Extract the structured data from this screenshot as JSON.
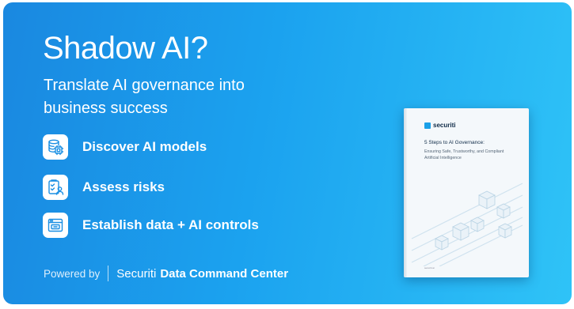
{
  "headline": "Shadow AI?",
  "subhead": "Translate AI governance into business success",
  "features": [
    {
      "label": "Discover AI models",
      "icon": "database-chip-icon"
    },
    {
      "label": "Assess risks",
      "icon": "checklist-user-icon"
    },
    {
      "label": "Establish data + AI controls",
      "icon": "browser-window-icon"
    }
  ],
  "footer": {
    "powered_by": "Powered by",
    "brand": "Securiti",
    "product": "Data Command Center"
  },
  "ebook": {
    "logo_text": "securiti",
    "title": "5 Steps to AI Governance:",
    "subtitle": "Ensuring Safe, Trustworthy, and Compliant Artificial Intelligence",
    "footer_text": "securiti.ai"
  },
  "colors": {
    "accent": "#1ba2ef",
    "icon_blue": "#1a8fe3"
  }
}
